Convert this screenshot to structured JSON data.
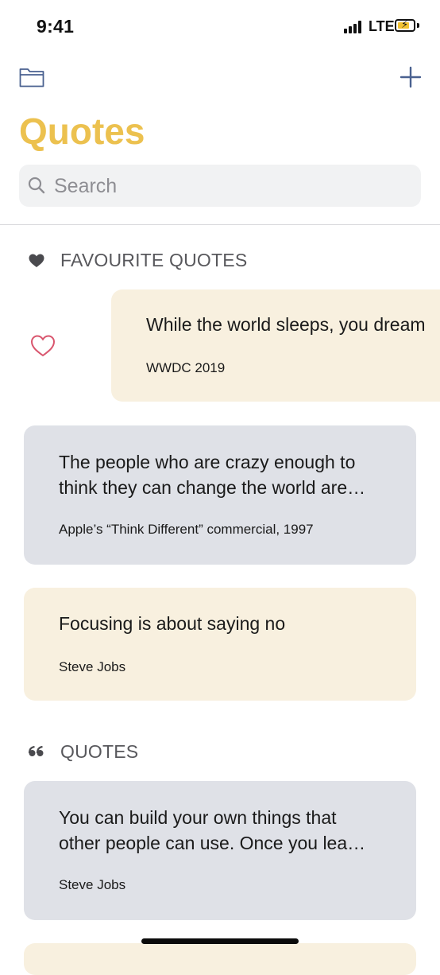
{
  "status_bar": {
    "time": "9:41",
    "network": "LTE"
  },
  "header": {
    "title": "Quotes"
  },
  "search": {
    "placeholder": "Search"
  },
  "sections": {
    "favourites": {
      "title": "FAVOURITE QUOTES"
    },
    "quotes": {
      "title": "QUOTES"
    }
  },
  "favourite_cards": [
    {
      "text": "While the world sleeps, you dream",
      "author": "WWDC 2019"
    },
    {
      "text": "The people who are crazy enough to\nthink they can change the world are…",
      "author": "Apple’s “Think Different” commercial, 1997"
    },
    {
      "text": "Focusing is about saying no",
      "author": "Steve Jobs"
    }
  ],
  "quote_cards": [
    {
      "text": "You can build your own things that\nother people can use. Once you lea…",
      "author": "Steve Jobs"
    }
  ],
  "colors": {
    "accent": "#ecc14f",
    "card_beige": "#f8f0df",
    "card_grey": "#dfe1e7",
    "icon_blue": "#4a6190",
    "heart_pink": "#d9566e"
  },
  "icons": {
    "folder": "folder-icon",
    "add": "plus-icon",
    "search": "magnifier-icon",
    "favourites_section": "heart-filled-icon",
    "quotes_section": "quote-mark-icon",
    "favourite_action": "heart-outline-icon"
  }
}
